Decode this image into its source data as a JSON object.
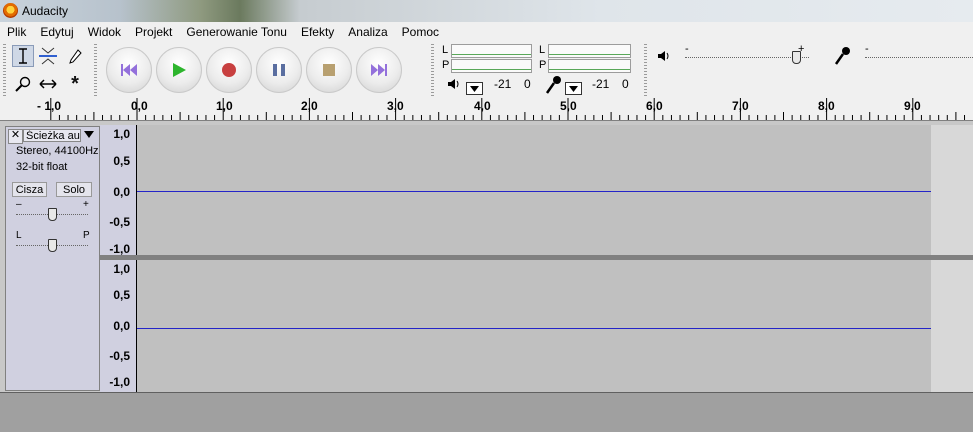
{
  "window": {
    "title": "Audacity"
  },
  "menu": [
    "Plik",
    "Edytuj",
    "Widok",
    "Projekt",
    "Generowanie Tonu",
    "Efekty",
    "Analiza",
    "Pomoc"
  ],
  "tools": [
    "selection-tool",
    "envelope-tool",
    "draw-tool",
    "zoom-tool",
    "timeshift-tool",
    "multi-tool"
  ],
  "transport": [
    "skip-to-start",
    "play",
    "record",
    "pause",
    "stop",
    "skip-to-end"
  ],
  "meters": {
    "output": {
      "left_label": "L",
      "right_label": "P",
      "db_value": "-21",
      "zero": "0"
    },
    "input": {
      "left_label": "L",
      "right_label": "P",
      "db_value": "-21",
      "zero": "0"
    }
  },
  "mixer": {
    "output_min": "-",
    "output_plus": "+",
    "input_min": "-",
    "output_level": 0.9
  },
  "ruler": [
    "- 1,0",
    "0,0",
    "1,0",
    "2,0",
    "3,0",
    "4,0",
    "5,0",
    "6,0",
    "7,0",
    "8,0",
    "9,0"
  ],
  "track": {
    "name": "Ścieżka au",
    "close": "✕",
    "format": "Stereo, 44100Hz",
    "bitdepth": "32-bit float",
    "mute": "Cisza",
    "solo": "Solo",
    "gain_minus": "–",
    "gain_plus": "+",
    "pan_left": "L",
    "pan_right": "P",
    "gain_level": 0.5,
    "pan_level": 0.5
  },
  "vruler": {
    "top": [
      "1,0",
      "0,5",
      "0,0",
      "-0,5",
      "-1,0"
    ],
    "bottom": [
      "1,0",
      "0,5",
      "0,0",
      "-0,5",
      "-1,0"
    ]
  },
  "colors": {
    "waveform": "#2424c8",
    "play": "#2db52d",
    "record": "#c84040",
    "pause": "#5a6ea0",
    "stop": "#b8a070",
    "skip": "#9370db"
  }
}
